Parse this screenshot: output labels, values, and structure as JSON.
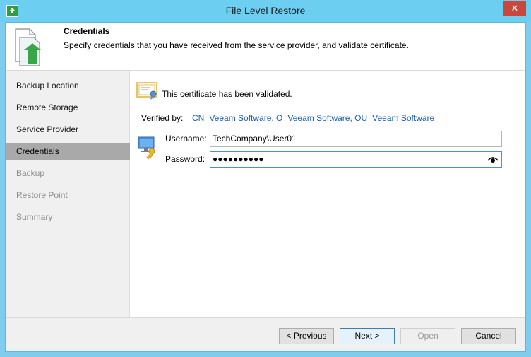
{
  "window": {
    "title": "File Level Restore",
    "close_glyph": "✕",
    "app_icon": "restore-app-icon"
  },
  "header": {
    "title": "Credentials",
    "description": "Specify credentials that you have received from the service provider, and validate certificate.",
    "icon": "file-restore-icon"
  },
  "sidebar": {
    "items": [
      {
        "label": "Backup Location",
        "state": "normal"
      },
      {
        "label": "Remote Storage",
        "state": "normal"
      },
      {
        "label": "Service Provider",
        "state": "normal"
      },
      {
        "label": "Credentials",
        "state": "active"
      },
      {
        "label": "Backup",
        "state": "disabled"
      },
      {
        "label": "Restore Point",
        "state": "disabled"
      },
      {
        "label": "Summary",
        "state": "disabled"
      }
    ]
  },
  "main": {
    "certificate_status": "This certificate has been validated.",
    "verified_by_label": "Verified by:",
    "verified_by_value": "CN=Veeam Software, O=Veeam Software, OU=Veeam Software",
    "username_label": "Username:",
    "username_value": "TechCompany\\User01",
    "password_label": "Password:",
    "password_value": "●●●●●●●●●●"
  },
  "footer": {
    "previous_label": "< Previous",
    "next_label": "Next >",
    "open_label": "Open",
    "cancel_label": "Cancel"
  },
  "colors": {
    "titlebar": "#6ccff2",
    "active_nav": "#a9a9a9",
    "link": "#1a5fb4",
    "close": "#c9473c"
  }
}
